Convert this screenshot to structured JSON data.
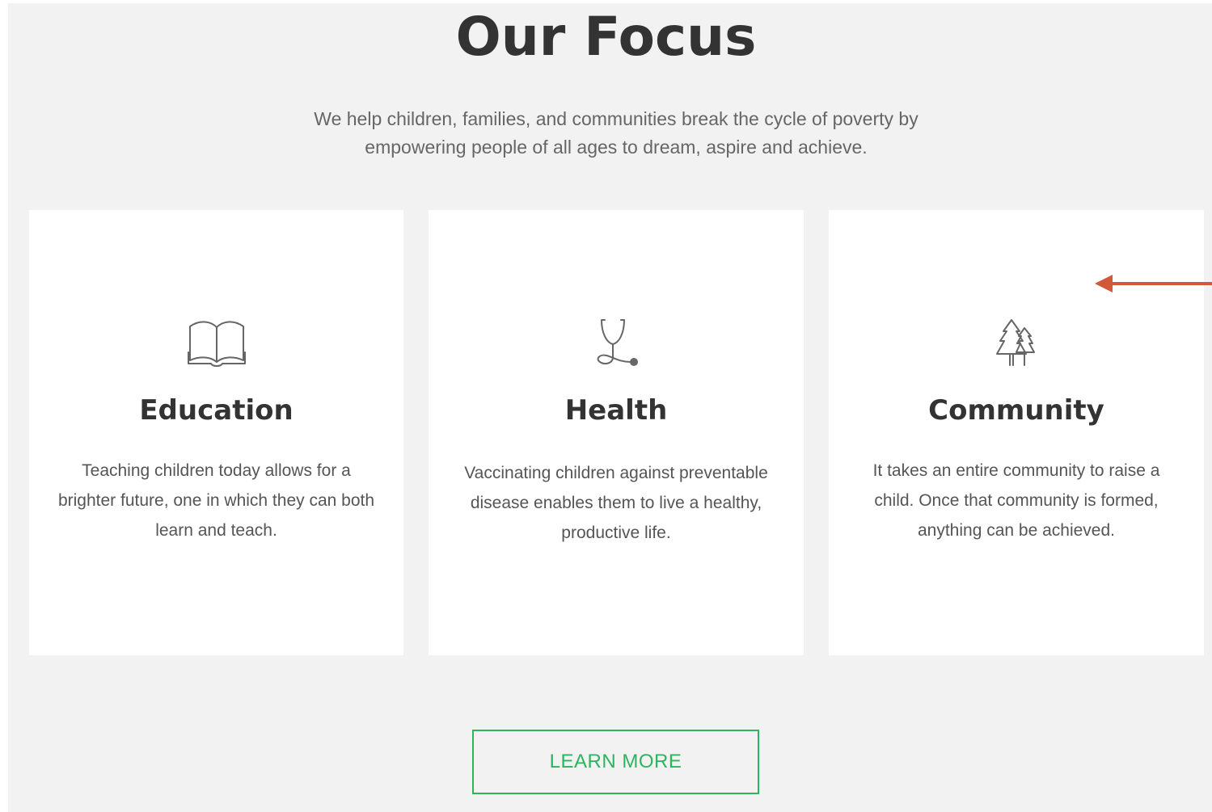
{
  "section": {
    "title": "Our Focus",
    "subtitle": "We help children, families, and communities break the cycle of poverty by empowering people of all ages to dream, aspire and achieve."
  },
  "cards": [
    {
      "icon": "open-book-icon",
      "heading": "Education",
      "text": "Teaching children today allows for a brighter future, one in which they can both learn and teach."
    },
    {
      "icon": "stethoscope-icon",
      "heading": "Health",
      "text": "Vaccinating children against preventable disease enables them to live a healthy, productive life."
    },
    {
      "icon": "trees-icon",
      "heading": "Community",
      "text": "It takes an entire community to raise a child. Once that community is formed, anything can be achieved."
    }
  ],
  "cta": {
    "label": "LEARN MORE"
  },
  "annotation": {
    "icon": "left-arrow-icon"
  },
  "colors": {
    "background": "#f2f2f2",
    "card": "#ffffff",
    "heading": "#333333",
    "body_text": "#555555",
    "accent_green": "#2eb35e",
    "annotation_arrow": "#d2583a",
    "icon_stroke": "#666666"
  }
}
